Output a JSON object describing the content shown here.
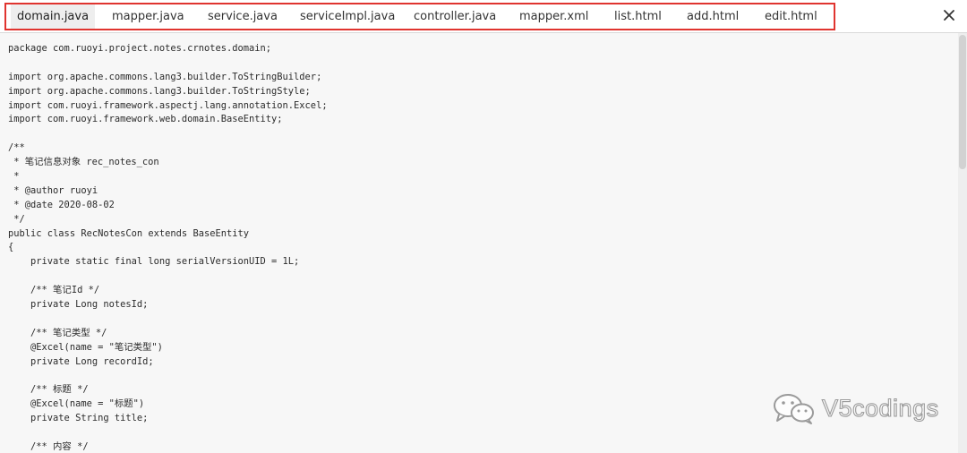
{
  "tabs": [
    {
      "label": "domain.java",
      "active": true
    },
    {
      "label": "mapper.java",
      "active": false
    },
    {
      "label": "service.java",
      "active": false
    },
    {
      "label": "serviceImpl.java",
      "active": false
    },
    {
      "label": "controller.java",
      "active": false
    },
    {
      "label": "mapper.xml",
      "active": false
    },
    {
      "label": "list.html",
      "active": false
    },
    {
      "label": "add.html",
      "active": false
    },
    {
      "label": "edit.html",
      "active": false
    }
  ],
  "close_icon": "close-icon",
  "highlight_color": "#e0342f",
  "code_lines": [
    "package com.ruoyi.project.notes.crnotes.domain;",
    "",
    "import org.apache.commons.lang3.builder.ToStringBuilder;",
    "import org.apache.commons.lang3.builder.ToStringStyle;",
    "import com.ruoyi.framework.aspectj.lang.annotation.Excel;",
    "import com.ruoyi.framework.web.domain.BaseEntity;",
    "",
    "/**",
    " * 笔记信息对象 rec_notes_con",
    " *",
    " * @author ruoyi",
    " * @date 2020-08-02",
    " */",
    "public class RecNotesCon extends BaseEntity",
    "{",
    "    private static final long serialVersionUID = 1L;",
    "",
    "    /** 笔记Id */",
    "    private Long notesId;",
    "",
    "    /** 笔记类型 */",
    "    @Excel(name = \"笔记类型\")",
    "    private Long recordId;",
    "",
    "    /** 标题 */",
    "    @Excel(name = \"标题\")",
    "    private String title;",
    "",
    "    /** 内容 */"
  ],
  "watermark": {
    "icon": "wechat-icon",
    "text": "V5codings"
  }
}
